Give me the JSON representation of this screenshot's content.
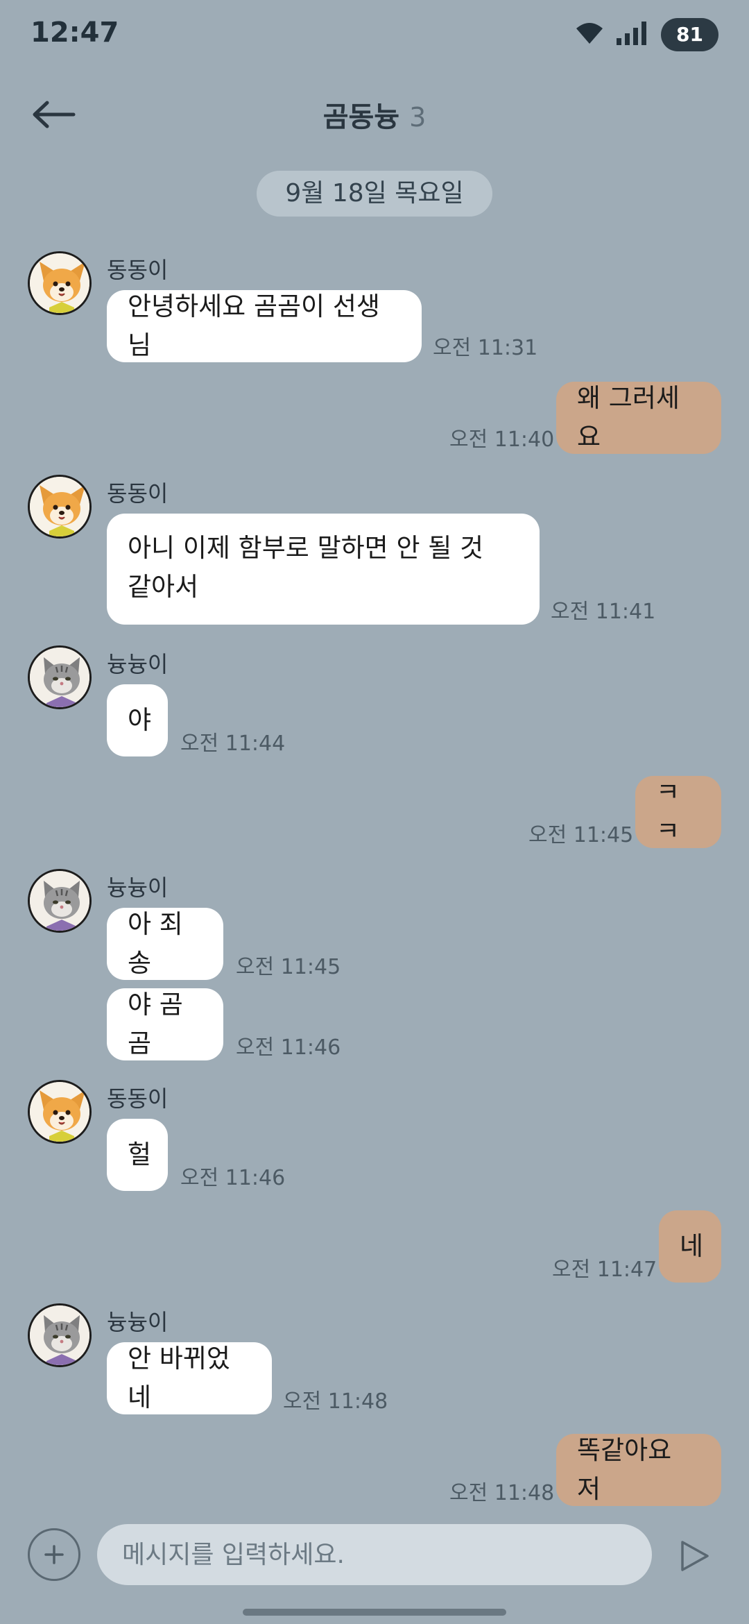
{
  "status_bar": {
    "time": "12:47",
    "battery": "81"
  },
  "header": {
    "title": "곰동늉",
    "member_count": "3"
  },
  "date_divider": "9월 18일 목요일",
  "messages": [
    {
      "sender": "동동이",
      "text": "안녕하세요 곰곰이 선생님",
      "time": "오전 11:31",
      "mine": false
    },
    {
      "sender": "",
      "text": "왜 그러세요",
      "time": "오전 11:40",
      "mine": true
    },
    {
      "sender": "동동이",
      "text_lines": [
        "아니 이제 함부로 말하면 안 될 것",
        "같아서"
      ],
      "time": "오전 11:41",
      "mine": false
    },
    {
      "sender": "늉늉이",
      "text": "야",
      "time": "오전 11:44",
      "mine": false
    },
    {
      "sender": "",
      "text": "ㅋㅋ",
      "time": "오전 11:45",
      "mine": true
    },
    {
      "sender": "늉늉이",
      "text": "아 죄송",
      "time": "오전 11:45",
      "mine": false
    },
    {
      "sender": "",
      "text": "야 곰곰",
      "time": "오전 11:46",
      "mine": false
    },
    {
      "sender": "동동이",
      "text": "헐",
      "time": "오전 11:46",
      "mine": false
    },
    {
      "sender": "",
      "text": "네",
      "time": "오전 11:47",
      "mine": true
    },
    {
      "sender": "늉늉이",
      "text": "안 바뀌었네",
      "time": "오전 11:48",
      "mine": false
    },
    {
      "sender": "",
      "text": "똑같아요 저",
      "time": "오전 11:48",
      "mine": true
    }
  ],
  "input": {
    "placeholder": "메시지를 입력하세요."
  },
  "icons": {
    "back": "arrow-left-icon",
    "wifi": "wifi-icon",
    "signal": "signal-icon",
    "plus": "plus-icon",
    "send": "send-icon",
    "dog_avatar": "dog-avatar",
    "cat_avatar": "cat-avatar"
  },
  "colors": {
    "background": "#9eacb6",
    "incoming_bubble": "#ffffff",
    "outgoing_bubble": "#cba68a",
    "date_pill": "#b8c4cc"
  }
}
